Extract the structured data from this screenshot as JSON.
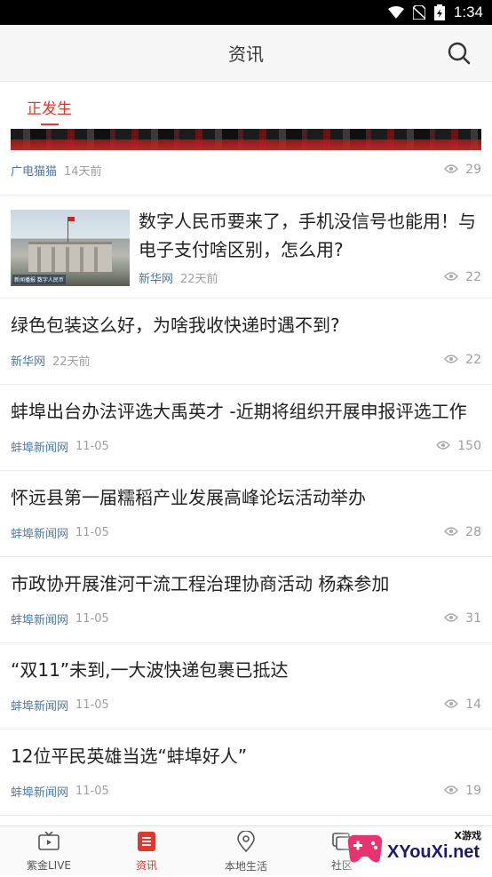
{
  "status_bar": {
    "time": "1:34"
  },
  "header": {
    "title": "资讯"
  },
  "tabs": [
    {
      "label": "正发生"
    }
  ],
  "first_item": {
    "source": "广电猫猫",
    "time": "14天前",
    "views": "29"
  },
  "items": [
    {
      "title": "数字人民币要来了，手机没信号也能用！与电子支付啥区别，怎么用?",
      "source": "新华网",
      "time": "22天前",
      "views": "22",
      "has_thumbnail": true,
      "thumbnail_caption": "新闻播报 数字人民币"
    },
    {
      "title": "绿色包装这么好，为啥我收快递时遇不到?",
      "source": "新华网",
      "time": "22天前",
      "views": "22"
    },
    {
      "title": "蚌埠出台办法评选大禹英才 -近期将组织开展申报评选工作",
      "source": "蚌埠新闻网",
      "time": "11-05",
      "views": "150"
    },
    {
      "title": "怀远县第一届糯稻产业发展高峰论坛活动举办",
      "source": "蚌埠新闻网",
      "time": "11-05",
      "views": "28"
    },
    {
      "title": "市政协开展淮河干流工程治理协商活动 杨森参加",
      "source": "蚌埠新闻网",
      "time": "11-05",
      "views": "31"
    },
    {
      "title": "“双11”未到,一大波快递包裹已抵达",
      "source": "蚌埠新闻网",
      "time": "11-05",
      "views": "14"
    },
    {
      "title": "12位平民英雄当选“蚌埠好人”",
      "source": "蚌埠新闻网",
      "time": "11-05",
      "views": "19"
    }
  ],
  "bottom_nav": [
    {
      "label": "紫金LIVE",
      "icon": "tv-icon",
      "active": false
    },
    {
      "label": "资讯",
      "icon": "news-list-icon",
      "active": true
    },
    {
      "label": "本地生活",
      "icon": "location-pin-icon",
      "active": false
    },
    {
      "label": "社区",
      "icon": "community-icon",
      "active": false
    }
  ],
  "watermark": {
    "text": "XYouXi.net",
    "small": "X游戏"
  },
  "colors": {
    "accent": "#e0382e",
    "source": "#4a79a8",
    "meta": "#a0a0a0"
  }
}
